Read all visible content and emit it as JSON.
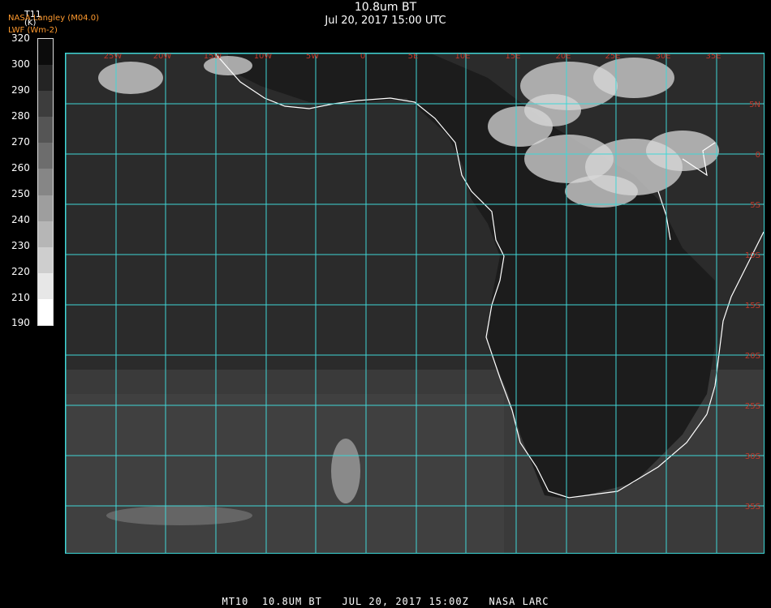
{
  "header": {
    "title": "10.8um BT",
    "subtitle": "Jul 20, 2017 15:00 UTC",
    "provider": "NASA Langley (M04.0)",
    "unit_label": "LWF (Wm-2)",
    "variable": "T11"
  },
  "colorbar": {
    "unit": "(K)",
    "ticks": [
      "320",
      "300",
      "290",
      "280",
      "270",
      "260",
      "250",
      "240",
      "230",
      "220",
      "210",
      "190"
    ]
  },
  "map": {
    "lon_labels": [
      "25W",
      "20W",
      "15W",
      "10W",
      "5W",
      "0",
      "5E",
      "10E",
      "15E",
      "20E",
      "25E",
      "30E",
      "35E"
    ],
    "lat_labels": [
      "5N",
      "0",
      "5S",
      "10S",
      "15S",
      "20S",
      "25S",
      "30S",
      "35S",
      "40S"
    ],
    "grid_color": "#3fd6d6",
    "label_color": "#c0392b",
    "coast_color": "#ffffff"
  },
  "footer": {
    "text": "MT10  10.8UM BT   JUL 20, 2017 15:00Z   NASA LARC"
  }
}
